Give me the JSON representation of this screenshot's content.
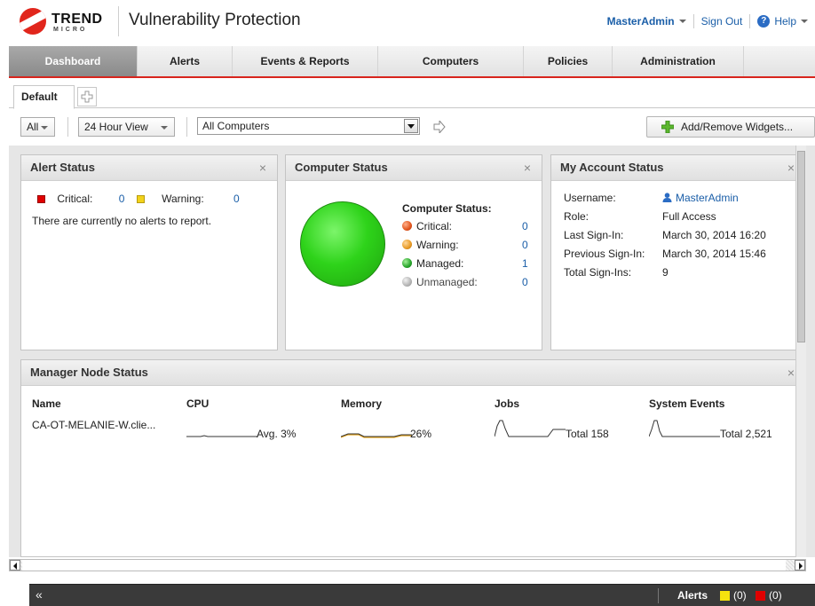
{
  "header": {
    "brand": "TREND",
    "brand_sub": "MICRO",
    "app_title": "Vulnerability Protection",
    "user": "MasterAdmin",
    "sign_out": "Sign Out",
    "help": "Help"
  },
  "nav": {
    "tabs": [
      {
        "label": "Dashboard",
        "active": true
      },
      {
        "label": "Alerts"
      },
      {
        "label": "Events & Reports"
      },
      {
        "label": "Computers"
      },
      {
        "label": "Policies"
      },
      {
        "label": "Administration"
      }
    ]
  },
  "dashboard_tabs": {
    "default": "Default"
  },
  "toolbar": {
    "filter": "All",
    "time_view": "24 Hour View",
    "computers": "All Computers",
    "add_remove": "Add/Remove Widgets..."
  },
  "alert_status": {
    "title": "Alert Status",
    "critical_label": "Critical:",
    "critical_count": "0",
    "warning_label": "Warning:",
    "warning_count": "0",
    "message": "There are currently no alerts to report.",
    "colors": {
      "critical": "#e00000",
      "warning": "#f2d21a"
    }
  },
  "computer_status": {
    "title": "Computer Status",
    "heading": "Computer Status:",
    "items": [
      {
        "label": "Critical:",
        "value": "0",
        "color": "#e2541c"
      },
      {
        "label": "Warning:",
        "value": "0",
        "color": "#e89a25"
      },
      {
        "label": "Managed:",
        "value": "1",
        "color": "#27a42a"
      },
      {
        "label": "Unmanaged:",
        "value": "0",
        "color": "#b4b4b4"
      }
    ],
    "overall_color": "#2ed31a"
  },
  "account_status": {
    "title": "My Account Status",
    "rows": [
      {
        "label": "Username:",
        "value": "MasterAdmin"
      },
      {
        "label": "Role:",
        "value": "Full Access"
      },
      {
        "label": "Last Sign-In:",
        "value": "March 30, 2014 16:20"
      },
      {
        "label": "Previous Sign-In:",
        "value": "March 30, 2014 15:46"
      },
      {
        "label": "Total Sign-Ins:",
        "value": "9"
      }
    ]
  },
  "manager_node": {
    "title": "Manager Node Status",
    "columns": [
      "Name",
      "CPU",
      "Memory",
      "Jobs",
      "System Events"
    ],
    "row": {
      "name": "CA-OT-MELANIE-W.clie...",
      "cpu": "Avg. 3%",
      "memory": "26%",
      "jobs": "Total 158",
      "events": "Total 2,521"
    }
  },
  "alert_bar": {
    "label": "Alerts",
    "warning_count": "(0)",
    "critical_count": "(0)",
    "colors": {
      "warning": "#f5e20e",
      "critical": "#e00000"
    }
  },
  "icons": [
    "trend-micro-logo",
    "help-icon",
    "add-tab-icon",
    "go-arrow-icon",
    "add-widget-icon",
    "close-icon",
    "user-icon",
    "collapse-icon"
  ]
}
